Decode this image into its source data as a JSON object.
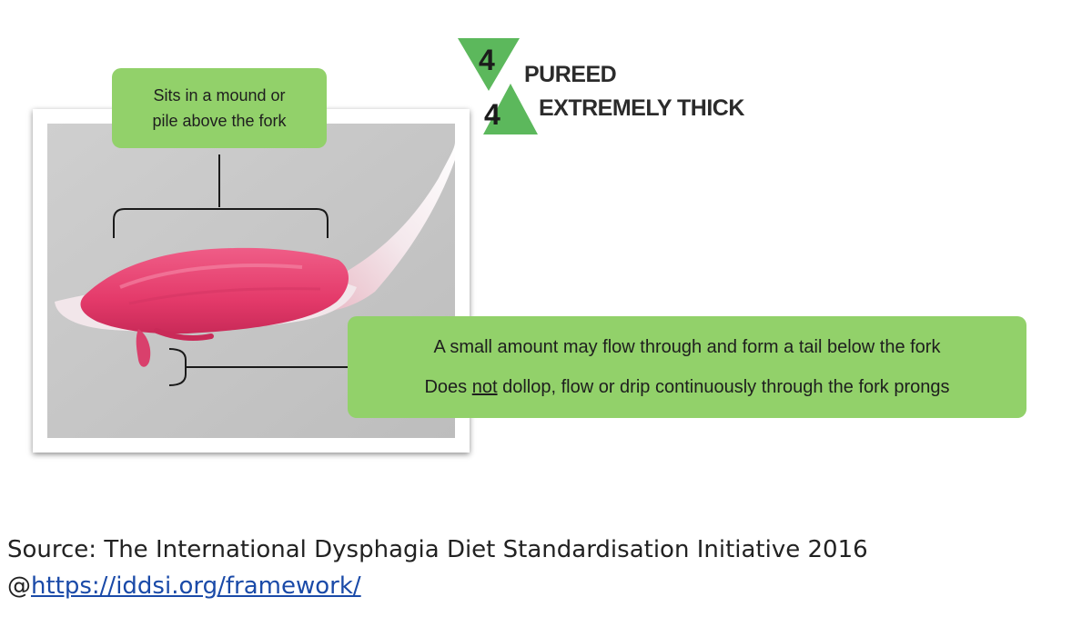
{
  "diagram": {
    "logo": {
      "top_number": "4",
      "bottom_number": "4",
      "color": "#5cb85c"
    },
    "level_labels": {
      "top": "PUREED",
      "bottom": "EXTREMELY THICK"
    },
    "callouts": {
      "top": {
        "line1": "Sits in a mound or",
        "line2": "pile above the fork"
      },
      "bottom": {
        "line1": "A small amount may flow through and form a tail below the fork",
        "line2_before": "Does ",
        "line2_underlined": "not",
        "line2_after": " dollop, flow or drip continuously through the fork prongs"
      },
      "color": "#92d16a"
    }
  },
  "source": {
    "text": "Source: The International Dysphagia Diet Standardisation Initiative 2016",
    "prefix": "@",
    "link_text": "https://iddsi.org/framework/"
  }
}
